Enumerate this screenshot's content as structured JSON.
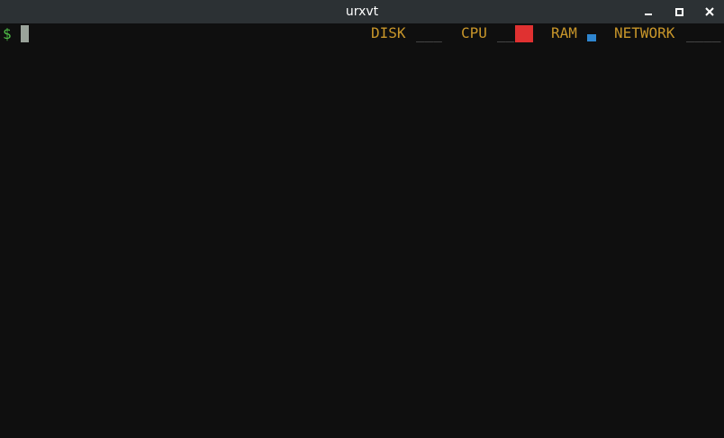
{
  "window": {
    "title": "urxvt",
    "controls": [
      "minimize",
      "maximize",
      "close"
    ]
  },
  "terminal": {
    "prompt": "$",
    "status_bar": {
      "disk": {
        "label": "DISK",
        "graph": "___"
      },
      "cpu": {
        "label": "CPU",
        "graph": "__",
        "level_color": "#e03131"
      },
      "ram": {
        "label": "RAM",
        "level_color": "#2f86d0"
      },
      "network": {
        "label": "NETWORK",
        "graph": "____"
      }
    }
  },
  "colors": {
    "titlebar": "#2c3134",
    "background": "#0f0f0f",
    "prompt": "#4fbf47",
    "status_label": "#c8962a",
    "cursor": "#9aa39a"
  }
}
